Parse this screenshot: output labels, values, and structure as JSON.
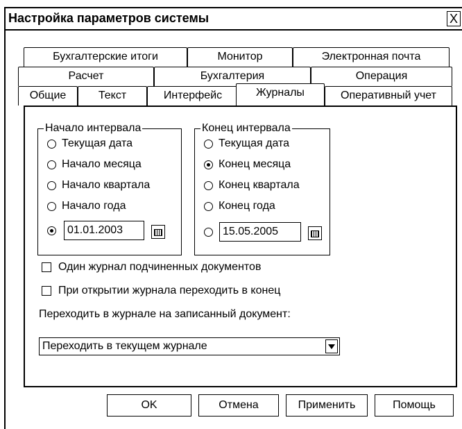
{
  "window": {
    "title": "Настройка параметров системы",
    "close_label": "X"
  },
  "tabs": {
    "row1": [
      "Бухгалтерские итоги",
      "Монитор",
      "Электронная почта"
    ],
    "row2": [
      "Расчет",
      "Бухгалтерия",
      "Операция"
    ],
    "row3": [
      "Общие",
      "Текст",
      "Интерфейс",
      "Журналы",
      "Оперативный учет"
    ],
    "active": "Журналы"
  },
  "interval_start": {
    "legend": "Начало интервала",
    "options": [
      "Текущая дата",
      "Начало месяца",
      "Начало квартала",
      "Начало года"
    ],
    "selected": "custom",
    "date": "01.01.2003"
  },
  "interval_end": {
    "legend": "Конец интервала",
    "options": [
      "Текущая дата",
      "Конец месяца",
      "Конец квартала",
      "Конец года"
    ],
    "selected": "Конец месяца",
    "date": "15.05.2005"
  },
  "checkboxes": {
    "one_journal": {
      "label": "Один журнал подчиненных документов",
      "checked": false
    },
    "go_to_end": {
      "label": "При открытии журнала переходить в конец",
      "checked": false
    }
  },
  "navigate": {
    "label": "Переходить в журнале на записанный документ:",
    "value": "Переходить в текущем журнале"
  },
  "buttons": {
    "ok": "OK",
    "cancel": "Отмена",
    "apply": "Применить",
    "help": "Помощь"
  }
}
